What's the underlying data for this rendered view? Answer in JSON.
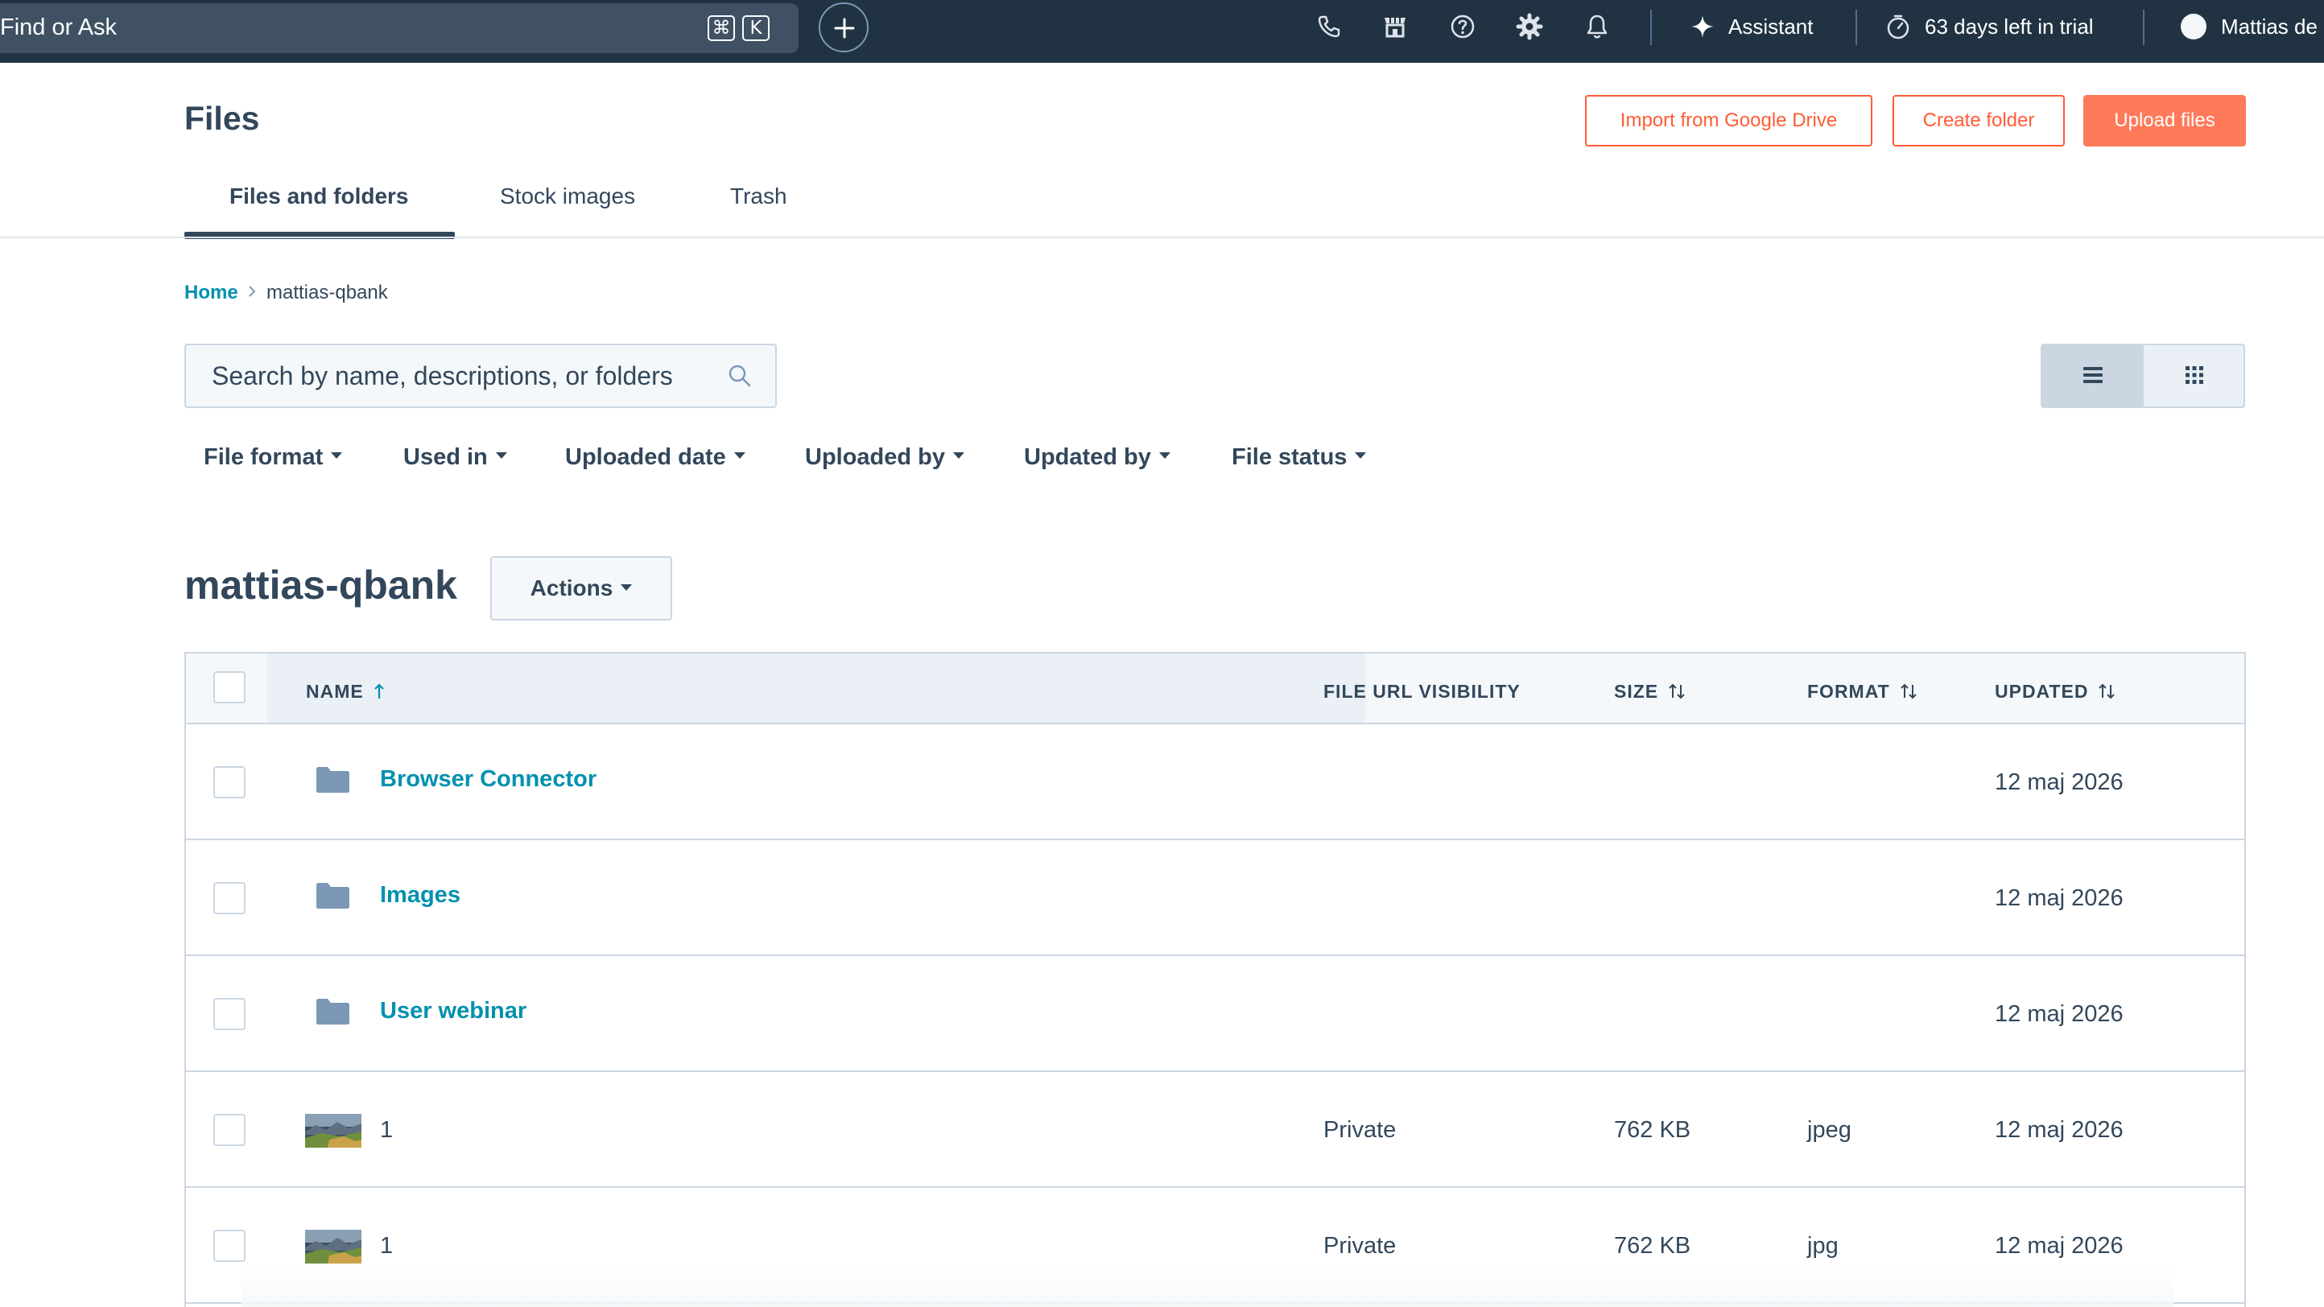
{
  "topbar": {
    "find_label": "Find or Ask",
    "shortcut_cmd": "⌘",
    "shortcut_key": "K",
    "assistant_label": "Assistant",
    "trial_label": "63 days left in trial",
    "user_label": "Mattias de",
    "icons": [
      "plus-icon",
      "phone-icon",
      "marketplace-icon",
      "help-icon",
      "settings-icon",
      "bell-icon",
      "sparkle-icon",
      "timer-icon",
      "avatar"
    ]
  },
  "header": {
    "title": "Files",
    "import_label": "Import from Google Drive",
    "create_folder_label": "Create folder",
    "upload_label": "Upload files"
  },
  "tabs": [
    {
      "label": "Files and folders",
      "active": true
    },
    {
      "label": "Stock images",
      "active": false
    },
    {
      "label": "Trash",
      "active": false
    }
  ],
  "breadcrumb": {
    "home": "Home",
    "current": "mattias-qbank"
  },
  "search": {
    "placeholder": "Search by name, descriptions, or folders",
    "value": ""
  },
  "view_mode": "list",
  "filters": [
    "File format",
    "Used in",
    "Uploaded date",
    "Uploaded by",
    "Updated by",
    "File status"
  ],
  "folder": {
    "title": "mattias-qbank",
    "actions_label": "Actions"
  },
  "table": {
    "columns": {
      "name": "NAME",
      "visibility": "FILE URL VISIBILITY",
      "size": "SIZE",
      "format": "FORMAT",
      "updated": "UPDATED"
    },
    "sorted_by": "name",
    "sort_direction": "ascending",
    "rows": [
      {
        "type": "folder",
        "name": "Browser Connector",
        "visibility": "",
        "size": "",
        "format": "",
        "updated": "12 maj 2026"
      },
      {
        "type": "folder",
        "name": "Images",
        "visibility": "",
        "size": "",
        "format": "",
        "updated": "12 maj 2026"
      },
      {
        "type": "folder",
        "name": "User webinar",
        "visibility": "",
        "size": "",
        "format": "",
        "updated": "12 maj 2026"
      },
      {
        "type": "image",
        "name": "1",
        "visibility": "Private",
        "size": "762 KB",
        "format": "jpeg",
        "updated": "12 maj 2026"
      },
      {
        "type": "image",
        "name": "1",
        "visibility": "Private",
        "size": "762 KB",
        "format": "jpg",
        "updated": "12 maj 2026"
      }
    ]
  },
  "colors": {
    "topbar_bg": "#213343",
    "accent_orange": "#ff5c35",
    "primary_button": "#ff7a59",
    "link_teal": "#0091ae",
    "text": "#33475b",
    "border": "#cbd6e2"
  }
}
